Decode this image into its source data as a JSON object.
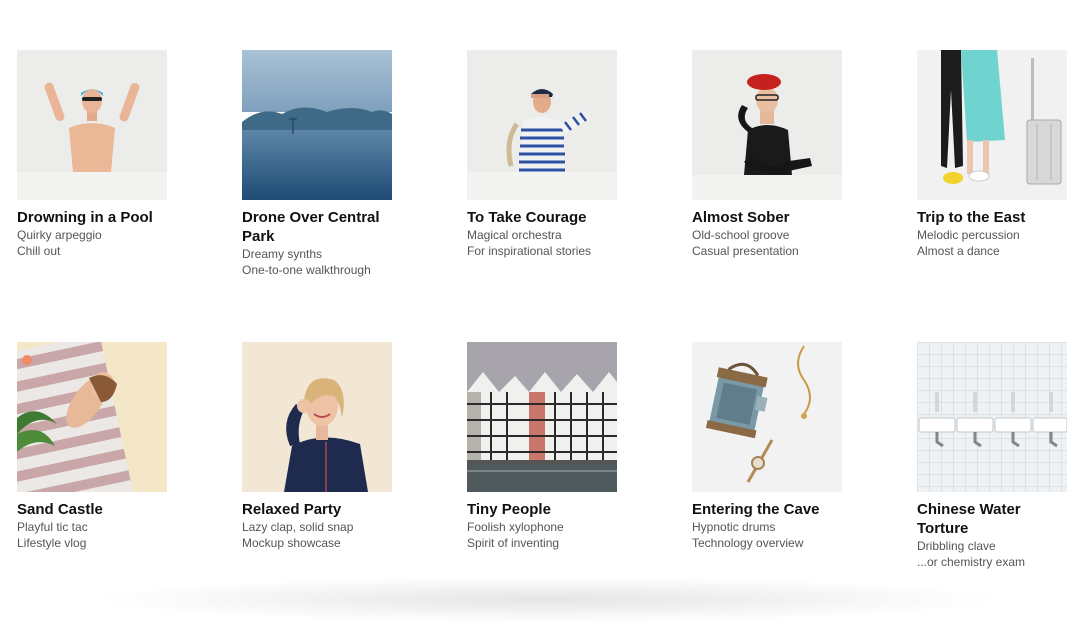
{
  "items": [
    {
      "title": "Drowning in a Pool",
      "line1": "Quirky arpeggio",
      "line2": "Chill out",
      "image": "swimmer-with-goggles"
    },
    {
      "title": "Drone Over Central Park",
      "line1": "Dreamy synths",
      "line2": "One-to-one walkthrough",
      "image": "foggy-lake"
    },
    {
      "title": "To Take Courage",
      "line1": "Magical orchestra",
      "line2": "For inspirational stories",
      "image": "sailor-saluting"
    },
    {
      "title": "Almost Sober",
      "line1": "Old-school groove",
      "line2": "Casual presentation",
      "image": "woman-red-beret"
    },
    {
      "title": "Trip to the East",
      "line1": "Melodic percussion",
      "line2": "Almost a dance",
      "image": "couple-with-suitcase"
    },
    {
      "title": "Sand Castle",
      "line1": "Playful tic tac",
      "line2": "Lifestyle vlog",
      "image": "woman-on-beach-towel"
    },
    {
      "title": "Relaxed Party",
      "line1": "Lazy clap, solid snap",
      "line2": "Mockup showcase",
      "image": "smiling-woman"
    },
    {
      "title": "Tiny People",
      "line1": "Foolish xylophone",
      "line2": "Spirit of inventing",
      "image": "waterfront-houses"
    },
    {
      "title": "Entering the Cave",
      "line1": "Hypnotic drums",
      "line2": "Technology overview",
      "image": "old-lantern"
    },
    {
      "title": "Chinese Water Torture",
      "line1": "Dribbling clave",
      "line2": "...or chemistry exam",
      "image": "tiled-sinks"
    }
  ]
}
